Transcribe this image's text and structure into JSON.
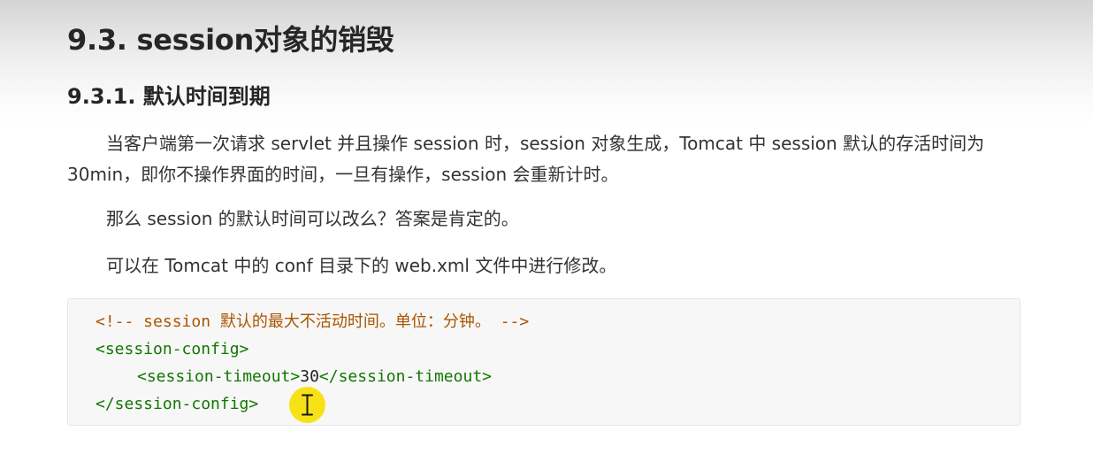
{
  "section_title": "9.3. session对象的销毁",
  "subsection_title": "9.3.1. 默认时间到期",
  "paragraphs": [
    "当客户端第一次请求 servlet 并且操作 session 时，session 对象生成，Tomcat 中 session 默认的存活时间为 30min，即你不操作界面的时间，一旦有操作，session 会重新计时。",
    "那么 session 的默认时间可以改么？答案是肯定的。",
    "可以在 Tomcat 中的 conf 目录下的 web.xml 文件中进行修改。"
  ],
  "code": {
    "comment": "<!-- session 默认的最大不活动时间。单位：分钟。 -->",
    "open_tag": "<session-config>",
    "timeout_open": "<session-timeout>",
    "timeout_value": "30",
    "timeout_close": "</session-timeout>",
    "close_tag": "</session-config>",
    "colors": {
      "comment": "#aa5500",
      "tag": "#117700",
      "text": "#222222"
    }
  },
  "cursor": {
    "icon": "text-cursor-icon",
    "highlight_color": "#f7e218"
  }
}
